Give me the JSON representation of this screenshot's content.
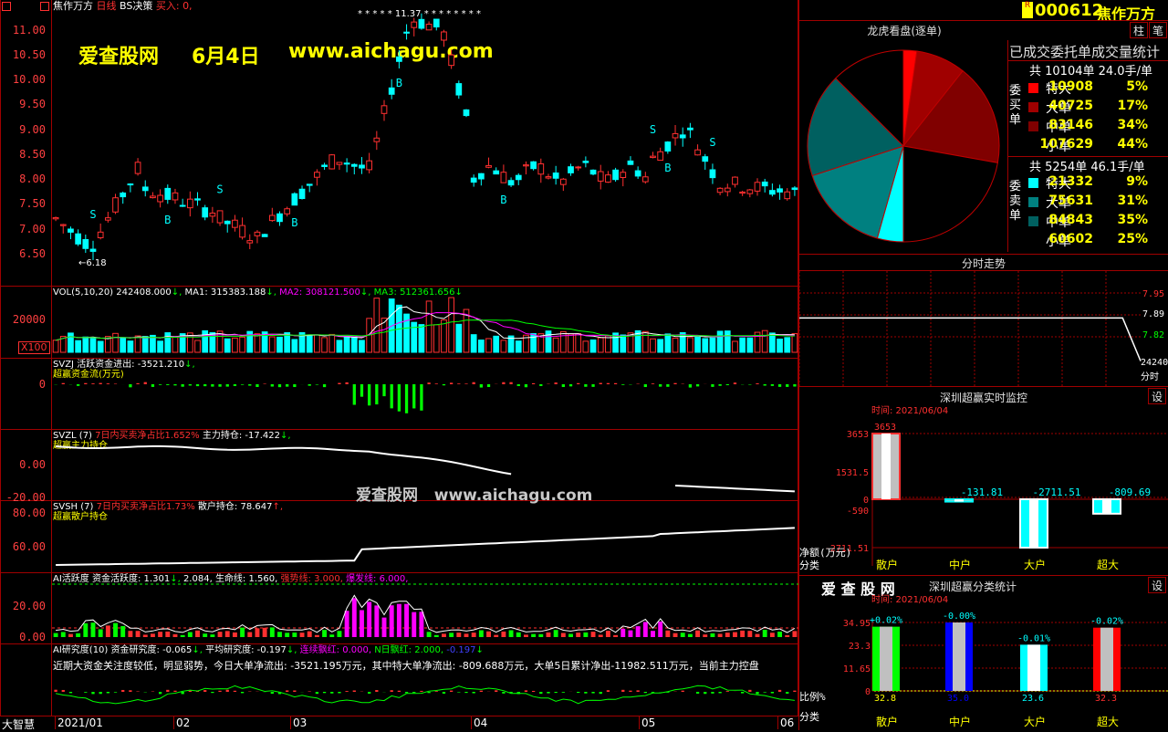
{
  "header": {
    "stock_name": "焦作万方",
    "period": "日线",
    "strategy": "BS决策",
    "buy_label": "买入:",
    "buy_value": "0,",
    "ticker": "000612",
    "ticker_name": "焦作万方",
    "flag_chars": "R",
    "top_stars": "* * * * * 11.37 * * * *   *   *   *   *"
  },
  "watermark": {
    "site": "爱查股网",
    "date": "6月4日",
    "url": "www.aichagu.com",
    "center": "爱查股网   www.aichagu.com",
    "corner": "爱 查 股 网"
  },
  "price_axis": [
    "11.00",
    "10.50",
    "10.00",
    "9.50",
    "9.00",
    "8.50",
    "8.00",
    "7.50",
    "7.00",
    "6.50"
  ],
  "price_low_marker": "6.18",
  "vol": {
    "label": "VOL(5,10,20)",
    "value": "242408.000",
    "ma1_label": "MA1:",
    "ma1": "315383.188",
    "ma2_label": "MA2:",
    "ma2": "308121.500",
    "ma3_label": "MA3:",
    "ma3": "512361.656",
    "axis": "20000",
    "unit": "X100"
  },
  "svzj": {
    "label": "SVZJ",
    "name": "活跃资金进出:",
    "value": "-3521.210",
    "sub": "超赢资金流(万元)",
    "axis0": "0"
  },
  "svzl": {
    "label": "SVZL (7)",
    "ratio": "7日内买卖净占比1.652%",
    "hold_label": "主力持仓:",
    "hold": "-17.422",
    "sub": "超赢主力持仓",
    "axis": [
      "0.00",
      "-20.00"
    ]
  },
  "svsh": {
    "label": "SVSH (7)",
    "ratio": "7日内买卖净占比1.73%",
    "hold_label": "散户持仓:",
    "hold": "78.647",
    "sub": "超赢散户持仓",
    "axis": [
      "80.00",
      "60.00"
    ]
  },
  "ai_active": {
    "label": "AI活跃度",
    "a_label": "资金活跃度:",
    "a": "1.301",
    "b": "2.084,",
    "c_label": "生命线:",
    "c": "1.560,",
    "d_label": "强势线:",
    "d": "3.000,",
    "e_label": "爆发线:",
    "e": "6.000,",
    "axis": [
      "20.00",
      "0.00"
    ]
  },
  "ai_research": {
    "label": "AI研究度(10)",
    "a_label": "资金研究度:",
    "a": "-0.065",
    "b_label": "平均研究度:",
    "b": "-0.197",
    "c_label": "连续飘红:",
    "c": "0.000,",
    "d_label": "N日飘红:",
    "d": "2.000,",
    "e": "-0.197",
    "note": "近期大资金关注度较低，明显弱势，今日大单净流出: -3521.195万元，其中特大单净流出: -809.688万元，大单5日累计净出-11982.511万元，当前主力控盘"
  },
  "time_axis": {
    "corner": "大智慧",
    "labels": [
      "2021/01",
      "02",
      "03",
      "04",
      "05",
      "06"
    ]
  },
  "dragon": {
    "title": "龙虎看盘(逐单)",
    "subtitle": "已成交委托单成交量统计",
    "buy_total": "共 10104单 24.0手/单",
    "sell_total": "共 5254单 46.1手/单",
    "buy_label": "委买单",
    "sell_label": "委卖单",
    "buy_rows": [
      {
        "name": "特大",
        "value": "10908",
        "pct": "5%"
      },
      {
        "name": "大单",
        "value": "40725",
        "pct": "17%"
      },
      {
        "name": "中单",
        "value": "83146",
        "pct": "34%"
      },
      {
        "name": "小单",
        "value": "107629",
        "pct": "44%"
      }
    ],
    "sell_rows": [
      {
        "name": "特大",
        "value": "21332",
        "pct": "9%"
      },
      {
        "name": "大单",
        "value": "75631",
        "pct": "31%"
      },
      {
        "name": "中单",
        "value": "84843",
        "pct": "35%"
      },
      {
        "name": "小单",
        "value": "60602",
        "pct": "25%"
      }
    ],
    "btn_a": "柱",
    "btn_b": "笔"
  },
  "intraday": {
    "title": "分时走势",
    "axis": [
      "7.95",
      "7.89",
      "7.82",
      "24240"
    ],
    "unit": "分时"
  },
  "monitor": {
    "title": "深圳超赢实时监控",
    "time": "时间: 2021/06/04",
    "btn": "设",
    "axis": [
      "3653",
      "1531.5",
      "0",
      "-590",
      "-2711.51"
    ],
    "top_value": "3653",
    "values": [
      "-131.81",
      "-2711.51",
      "-809.69"
    ],
    "ylabel": "净额(万元)",
    "xlabel": "分类",
    "cats": [
      "散户",
      "中户",
      "大户",
      "超大"
    ]
  },
  "classify": {
    "title": "深圳超赢分类统计",
    "time": "时间: 2021/06/04",
    "btn": "设",
    "axis": [
      "34.95",
      "23.3",
      "11.65",
      "0"
    ],
    "top_labels": [
      "+0.02%",
      "-0.00%",
      "-0.01%",
      "-0.02%"
    ],
    "bottom_labels": [
      "32.8",
      "35.0",
      "23.6",
      "32.3"
    ],
    "ylabel": "比例%",
    "xlabel": "分类",
    "cats": [
      "散户",
      "中户",
      "大户",
      "超大"
    ]
  },
  "chart_data": [
    {
      "type": "pie",
      "title": "龙虎看盘(逐单)",
      "labels": [
        "委买特大",
        "委买大单",
        "委买中单",
        "委买小单",
        "委卖特大",
        "委卖大单",
        "委卖中单",
        "委卖小单"
      ],
      "values": [
        10908,
        40725,
        83146,
        107629,
        21332,
        75631,
        84843,
        60602
      ],
      "colors": [
        "#ff0000",
        "#a00000",
        "#800000",
        "#000000",
        "#00ffff",
        "#008080",
        "#006060",
        "#000000"
      ]
    },
    {
      "type": "bar",
      "title": "深圳超赢实时监控",
      "categories": [
        "散户",
        "中户",
        "大户",
        "超大"
      ],
      "values": [
        3653,
        -131.81,
        -2711.51,
        -809.69
      ],
      "ylabel": "净额(万元)",
      "ylim": [
        -2711.51,
        3653
      ]
    },
    {
      "type": "bar",
      "title": "深圳超赢分类统计",
      "categories": [
        "散户",
        "中户",
        "大户",
        "超大"
      ],
      "values": [
        32.8,
        35.0,
        23.6,
        32.3
      ],
      "ylabel": "比例%",
      "ylim": [
        0,
        34.95
      ]
    },
    {
      "type": "line",
      "title": "分时走势",
      "yticks": [
        7.95,
        7.89,
        7.82
      ],
      "values": [
        7.86,
        7.86,
        7.86,
        7.86,
        7.86,
        7.86,
        7.86,
        7.86,
        7.86,
        7.86,
        7.86,
        7.86,
        7.86,
        7.86,
        7.86,
        7.86,
        7.86,
        7.86,
        7.86,
        7.75
      ]
    }
  ]
}
